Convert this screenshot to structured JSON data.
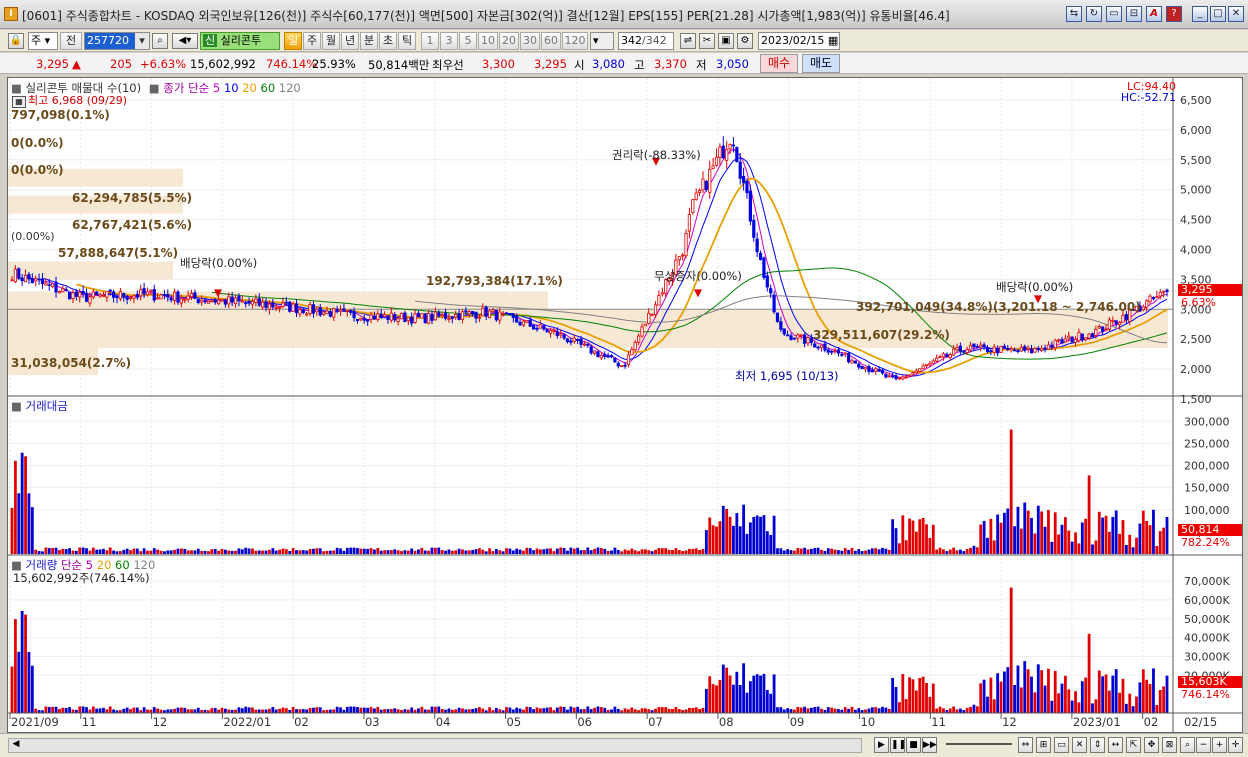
{
  "window": {
    "title": "[0601] 주식종합차트 - KOSDAQ 외국인보유[126(천)] 주식수[60,177(천)] 액면[500] 자본금[302(억)] 결산[12월] EPS[155] PER[21.28] 시가총액[1,983(억)] 유통비율[46.4]",
    "app_icon": "I"
  },
  "toolbar": {
    "market": "주",
    "prev_label": "전",
    "code": "257720",
    "stock_name": "실리콘투",
    "stock_badge": "신",
    "periods": [
      "일",
      "주",
      "월",
      "년",
      "분",
      "초",
      "틱"
    ],
    "active_period": "일",
    "intervals": [
      "1",
      "3",
      "5",
      "10",
      "20",
      "30",
      "60",
      "120"
    ],
    "count_value": "342",
    "count_total": "/342",
    "date": "2023/02/15"
  },
  "quote": {
    "price": "3,295",
    "arrow": "▲",
    "change": "205",
    "pct": "+6.63%",
    "volume": "15,602,992",
    "vol_ratio": "746.14%",
    "turnover": "25.93%",
    "amount": "50,814백만",
    "best_label": "최우선",
    "ask": "3,300",
    "bid": "3,295",
    "open_label": "시",
    "open": "3,080",
    "high_label": "고",
    "high": "3,370",
    "low_label": "저",
    "low": "3,050",
    "buy_label": "매수",
    "sell_label": "매도"
  },
  "price_panel": {
    "legend_main": "실리콘투 매물대 수(10)",
    "legend_ma": "종가 단순",
    "ma_periods": [
      "5",
      "10",
      "20",
      "60",
      "120"
    ],
    "ma_colors": [
      "#cc00cc",
      "#0000ff",
      "#e8a000",
      "#008000",
      "#808080"
    ],
    "lc": "LC:94.40",
    "hc": "HC:-52.71",
    "high_marker": "최고 6,968 (09/29)",
    "low_marker": "최저 1,695 (10/13)",
    "vp_labels": [
      "797,098(0.1%)",
      "0(0.0%)",
      "0(0.0%)",
      "62,294,785(5.5%)",
      "62,767,421(5.6%)",
      "(0.00%)",
      "57,888,647(5.1%)",
      "192,793,384(17.1%)",
      "392,701,049(34.8%)(3,201.18 ~ 2,746.00)",
      "329,511,607(29.2%)",
      "31,038,054(2.7%)"
    ],
    "events": [
      "배당락(0.00%)",
      "권리락(-88.33%)",
      "무상증자(0.00%)",
      "배당락(0.00%)"
    ],
    "y_ticks": [
      "6,500",
      "6,000",
      "5,500",
      "5,000",
      "4,500",
      "4,000",
      "3,500",
      "3,000",
      "2,500",
      "2,000",
      "1,500"
    ],
    "last_price": "3,295",
    "last_pct": "6.63%"
  },
  "amount_panel": {
    "legend": "거래대금",
    "y_ticks": [
      "300,000",
      "250,000",
      "200,000",
      "150,000",
      "100,000",
      "50,000"
    ],
    "last_value": "50,814",
    "last_pct": "782.24%"
  },
  "volume_panel": {
    "legend": "거래량",
    "legend_ma": "단순",
    "ma_periods": [
      "5",
      "20",
      "60",
      "120"
    ],
    "value_line": "15,602,992주(746.14%)",
    "y_ticks": [
      "70,000K",
      "60,000K",
      "50,000K",
      "40,000K",
      "30,000K",
      "20,000K"
    ],
    "last_value": "15,603K",
    "last_pct": "746.14%"
  },
  "x_axis": {
    "labels": [
      "2021/09",
      "11",
      "12",
      "2022/01",
      "02",
      "03",
      "04",
      "05",
      "06",
      "07",
      "08",
      "09",
      "10",
      "11",
      "12",
      "2023/01",
      "02"
    ],
    "right_label": "02/15"
  },
  "chart_data": {
    "type": "candlestick",
    "x_range": [
      "2021/09",
      "2023/02/15"
    ],
    "y_range": [
      1500,
      6700
    ],
    "monthly_close": [
      {
        "m": "2021/09",
        "v": 3600
      },
      {
        "m": "2021/10",
        "v": 3200
      },
      {
        "m": "2021/11",
        "v": 3250
      },
      {
        "m": "2021/12",
        "v": 3150
      },
      {
        "m": "2022/01",
        "v": 3050
      },
      {
        "m": "2022/02",
        "v": 2900
      },
      {
        "m": "2022/03",
        "v": 2850
      },
      {
        "m": "2022/04",
        "v": 2950
      },
      {
        "m": "2022/05",
        "v": 2600
      },
      {
        "m": "2022/06",
        "v": 2050
      },
      {
        "m": "2022/07",
        "v": 4300
      },
      {
        "m": "2022/08",
        "v": 2750
      },
      {
        "m": "2022/09",
        "v": 2350
      },
      {
        "m": "2022/10",
        "v": 1800
      },
      {
        "m": "2022/11",
        "v": 2350
      },
      {
        "m": "2022/12",
        "v": 2300
      },
      {
        "m": "2023/01",
        "v": 2650
      },
      {
        "m": "2023/02",
        "v": 3295
      }
    ],
    "peak": {
      "label": "최고",
      "value": 6968,
      "date": "09/29"
    },
    "trough": {
      "label": "최저",
      "value": 1695,
      "date": "10/13"
    }
  }
}
